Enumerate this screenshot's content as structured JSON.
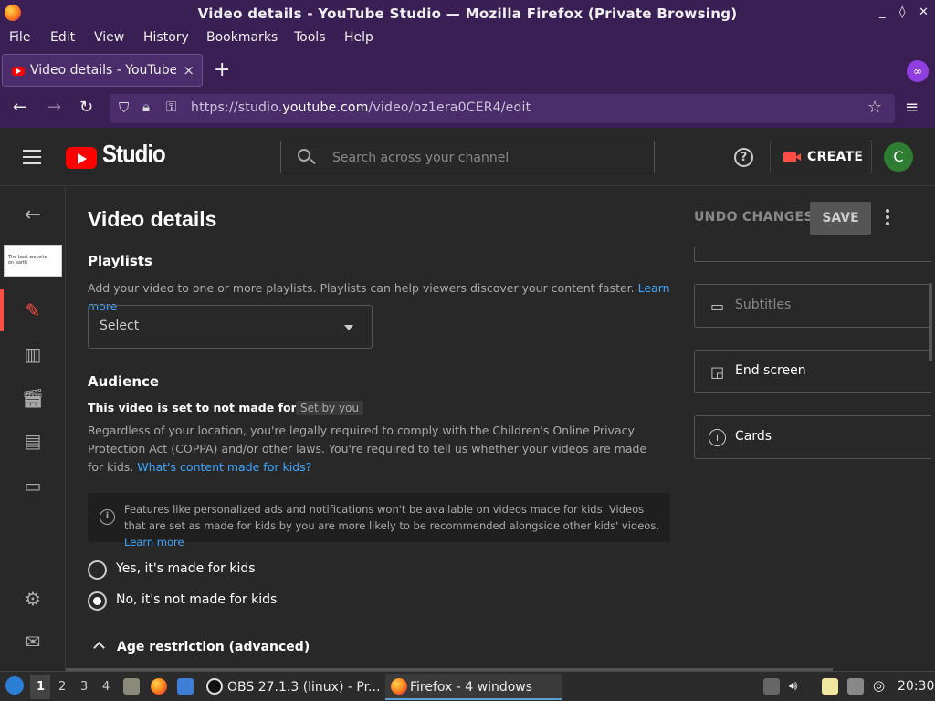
{
  "window": {
    "title": "Video details - YouTube Studio — Mozilla Firefox (Private Browsing)",
    "controls": [
      "_",
      "◊",
      "✕"
    ]
  },
  "menubar": [
    "File",
    "Edit",
    "View",
    "History",
    "Bookmarks",
    "Tools",
    "Help"
  ],
  "tab": {
    "title": "Video details - YouTube Studio",
    "close": "×",
    "new": "+"
  },
  "url": {
    "prefix": "https://studio.",
    "domain": "youtube.com",
    "path": "/video/oz1era0CER4/edit"
  },
  "studio": {
    "logo_text": "Studio",
    "search_placeholder": "Search across your channel",
    "help": "?",
    "create_label": "CREATE",
    "avatar_letter": "C"
  },
  "sidebar": {
    "thumbnail_text": "The best website on earth"
  },
  "page": {
    "title": "Video details",
    "undo_label": "UNDO CHANGES",
    "save_label": "SAVE",
    "playlists": {
      "heading": "Playlists",
      "description": "Add your video to one or more playlists. Playlists can help viewers discover your content faster.",
      "learn_more": "Learn more",
      "select_label": "Select"
    },
    "audience": {
      "heading": "Audience",
      "status": "This video is set to not made for kids",
      "badge": "Set by you",
      "description": "Regardless of your location, you're legally required to comply with the Children's Online Privacy Protection Act (COPPA) and/or other laws. You're required to tell us whether your videos are made for kids.",
      "link": "What's content made for kids?",
      "info": "Features like personalized ads and notifications won't be available on videos made for kids. Videos that are set as made for kids by you are more likely to be recommended alongside other kids' videos.",
      "info_link": "Learn more",
      "option_yes": "Yes, it's made for kids",
      "option_no": "No, it's not made for kids",
      "selected": "no"
    },
    "age_restriction": "Age restriction (advanced)"
  },
  "right_panel": {
    "subtitles": "Subtitles",
    "end_screen": "End screen",
    "cards": "Cards"
  },
  "taskbar": {
    "workspaces": [
      "1",
      "2",
      "3",
      "4"
    ],
    "obs": "OBS 27.1.3 (linux) - Pr...",
    "firefox": "Firefox - 4 windows",
    "clock": "20:30"
  }
}
